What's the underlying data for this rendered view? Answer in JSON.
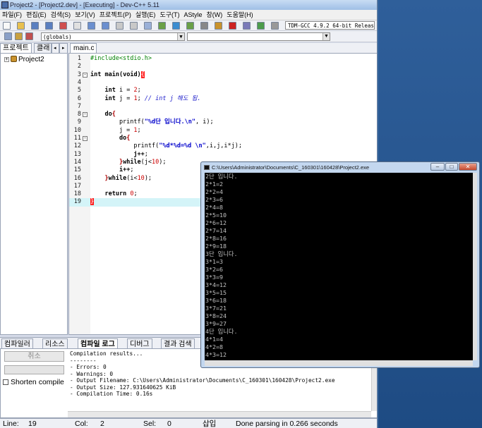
{
  "window_title": "Project2 - [Project2.dev] - [Executing] - Dev-C++ 5.11",
  "menu": [
    "파일(F)",
    "편집(E)",
    "검색(S)",
    "보기(V)",
    "프로젝트(P)",
    "실행(E)",
    "도구(T)",
    "AStyle",
    "창(W)",
    "도움말(H)"
  ],
  "toolbar": {
    "compiler": "TDM-GCC 4.9.2 64-bit Release",
    "scope": "(globals)"
  },
  "left_tabs": [
    "프로젝트",
    "클래"
  ],
  "project_name": "Project2",
  "editor_tab": "main.c",
  "code_lines": [
    {
      "num": "1",
      "html": "<span class='pp'>#include&lt;stdio.h&gt;</span>"
    },
    {
      "num": "2",
      "html": ""
    },
    {
      "num": "3",
      "html": "<span class='k'>int</span> <span class='k'>main</span><span class='k'>(void)</span><span class='ob'>{</span>",
      "fold": "-"
    },
    {
      "num": "4",
      "html": ""
    },
    {
      "num": "5",
      "html": "    <span class='k'>int</span> i = <span class='n'>2</span>;"
    },
    {
      "num": "6",
      "html": "    <span class='k'>int</span> j = <span class='n'>1</span>; <span class='c'>// int j 해도 됨.</span>"
    },
    {
      "num": "7",
      "html": ""
    },
    {
      "num": "8",
      "html": "    <span class='k'>do</span><span class='br'>{</span>",
      "fold": "-"
    },
    {
      "num": "9",
      "html": "        printf(<span class='s'>\"%d단 입니다.\\n\"</span>, i);"
    },
    {
      "num": "10",
      "html": "        j = <span class='n'>1</span>;"
    },
    {
      "num": "11",
      "html": "        <span class='k'>do</span><span class='br'>{</span>",
      "fold": "-"
    },
    {
      "num": "12",
      "html": "            printf(<span class='s'>\"%d*%d=%d \\n\"</span>,i,j,i*j);"
    },
    {
      "num": "13",
      "html": "            <span class='k'>j++</span>;"
    },
    {
      "num": "14",
      "html": "        <span class='br'>}</span><span class='k'>while</span>(j&lt;<span class='n'>10</span>);"
    },
    {
      "num": "15",
      "html": "        <span class='k'>i++</span>;"
    },
    {
      "num": "16",
      "html": "    <span class='br'>}</span><span class='k'>while</span>(i&lt;<span class='n'>10</span>);"
    },
    {
      "num": "17",
      "html": ""
    },
    {
      "num": "18",
      "html": "    <span class='k'>return</span> <span class='n'>0</span>;"
    },
    {
      "num": "19",
      "html": "<span class='ob'>}</span>",
      "current": true
    }
  ],
  "bottom_tabs": [
    "컴파일러",
    "리소스",
    "컴파일 로그",
    "디버그",
    "결과 검색"
  ],
  "cancel_label": "취소",
  "shorten_label": "Shorten compile",
  "compile_log": [
    "Compilation results...",
    "--------",
    "- Errors: 0",
    "- Warnings: 0",
    "- Output Filename: C:\\Users\\Administrator\\Documents\\C_160301\\160428\\Project2.exe",
    "- Output Size: 127.931640625 KiB",
    "- Compilation Time: 0.16s"
  ],
  "status": {
    "line_label": "Line:",
    "line_value": "19",
    "col_label": "Col:",
    "col_value": "2",
    "sel_label": "Sel:",
    "sel_value": "0",
    "mode": "삽입",
    "message": "Done parsing in 0.266 seconds"
  },
  "console": {
    "title": "C:\\Users\\Administrator\\Documents\\C_160301\\160428\\Project2.exe",
    "lines": [
      "2단 입니다.",
      "2*1=2",
      "2*2=4",
      "2*3=6",
      "2*4=8",
      "2*5=10",
      "2*6=12",
      "2*7=14",
      "2*8=16",
      "2*9=18",
      "3단 입니다.",
      "3*1=3",
      "3*2=6",
      "3*3=9",
      "3*4=12",
      "3*5=15",
      "3*6=18",
      "3*7=21",
      "3*8=24",
      "3*9=27",
      "4단 입니다.",
      "4*1=4",
      "4*2=8",
      "4*3=12",
      "4*4=16"
    ]
  }
}
